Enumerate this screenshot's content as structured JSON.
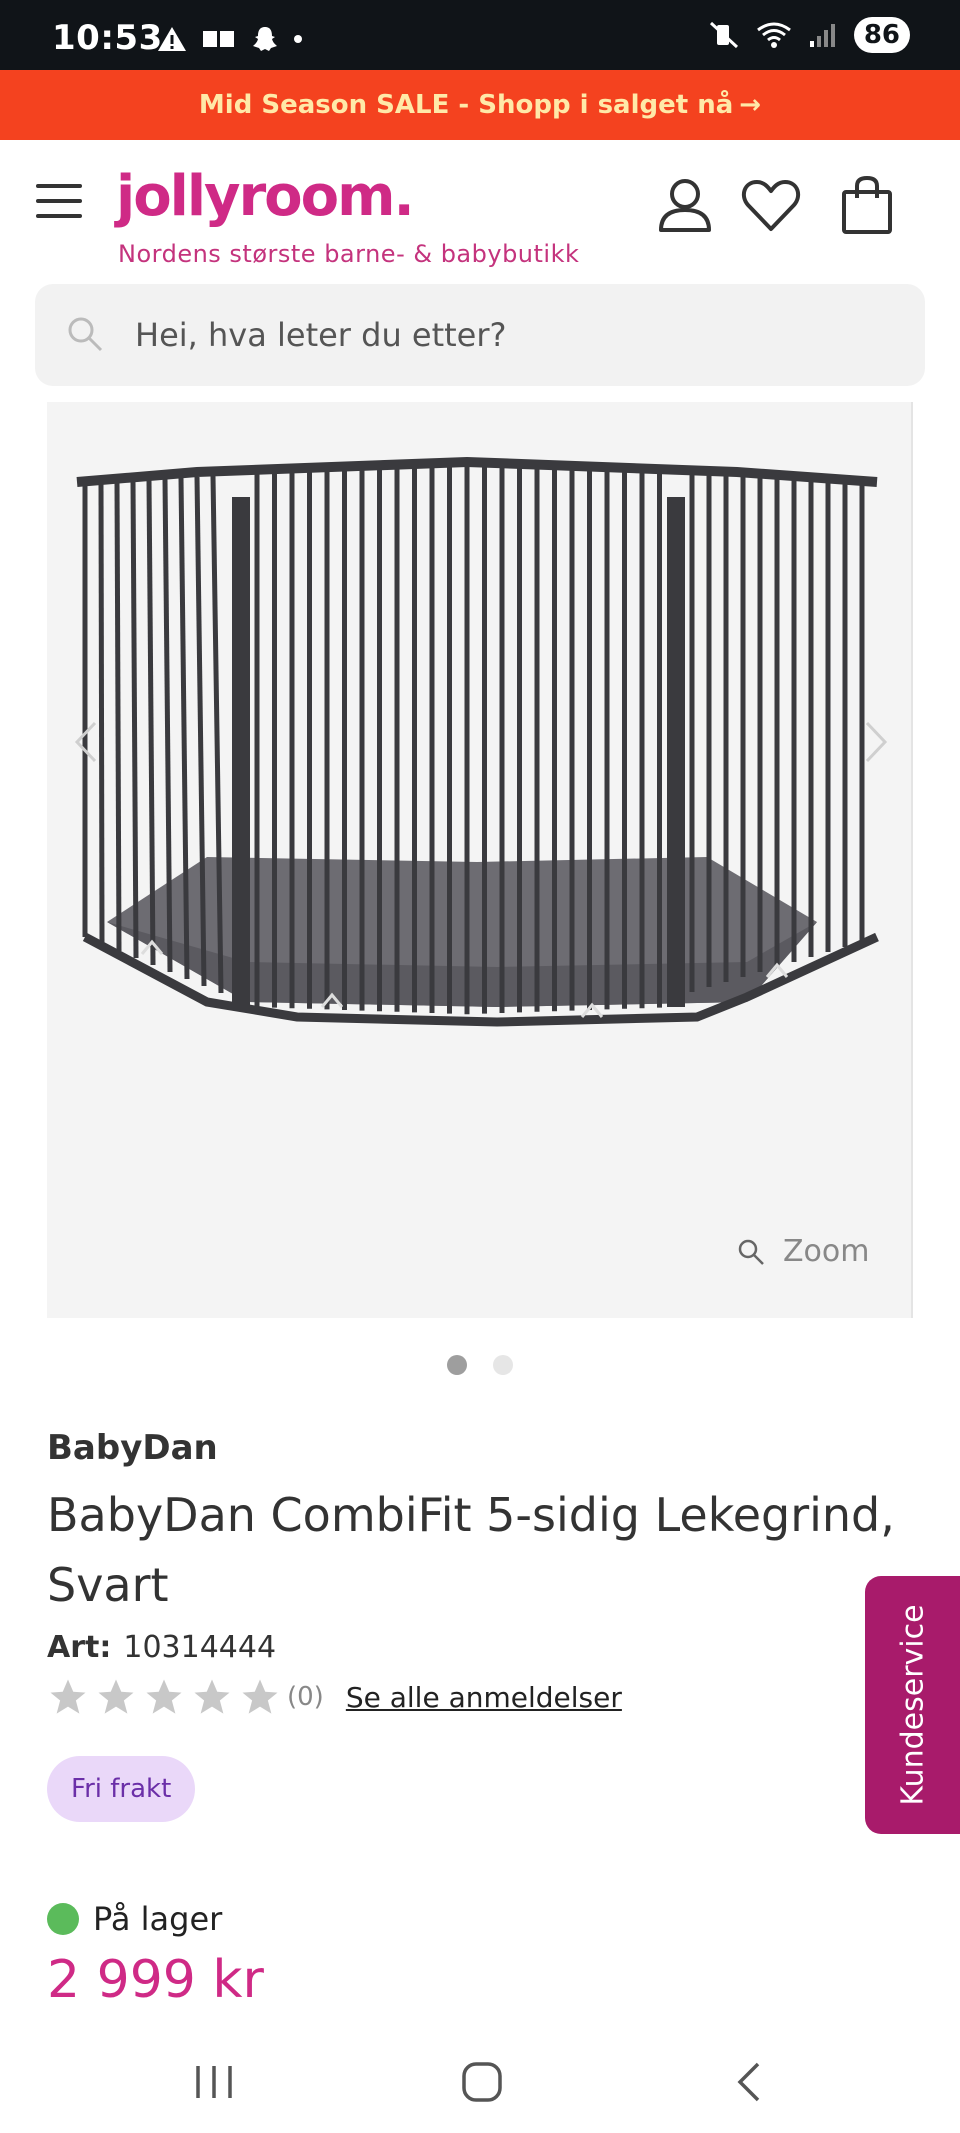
{
  "status_bar": {
    "time": "10:53",
    "battery": "86"
  },
  "promo": {
    "text": "Mid Season SALE - Shopp i salget nå",
    "arrow": "→"
  },
  "header": {
    "logo": "jollyroom.",
    "tagline": "Nordens største barne- & babybutikk"
  },
  "search": {
    "placeholder": "Hei, hva leter du etter?"
  },
  "gallery": {
    "zoom_label": "Zoom",
    "slide_count": 2,
    "active_slide": 1
  },
  "product": {
    "brand": "BabyDan",
    "title": "BabyDan CombiFit 5-sidig Lekegrind, Svart",
    "art_label": "Art:",
    "art_number": "10314444",
    "rating_stars": 0,
    "review_count": "(0)",
    "reviews_link": "Se alle anmeldelser",
    "badge": "Fri frakt",
    "stock": "På lager",
    "price": "2 999 kr"
  },
  "customer_service": {
    "label": "Kundeservice"
  },
  "colors": {
    "brand_pink": "#cf2a86",
    "promo_bg": "#f4421f",
    "promo_text": "#ffe9a8",
    "kundeservice_bg": "#a81b6b",
    "badge_bg": "#ead8f9",
    "stock_green": "#5bbb5b"
  }
}
